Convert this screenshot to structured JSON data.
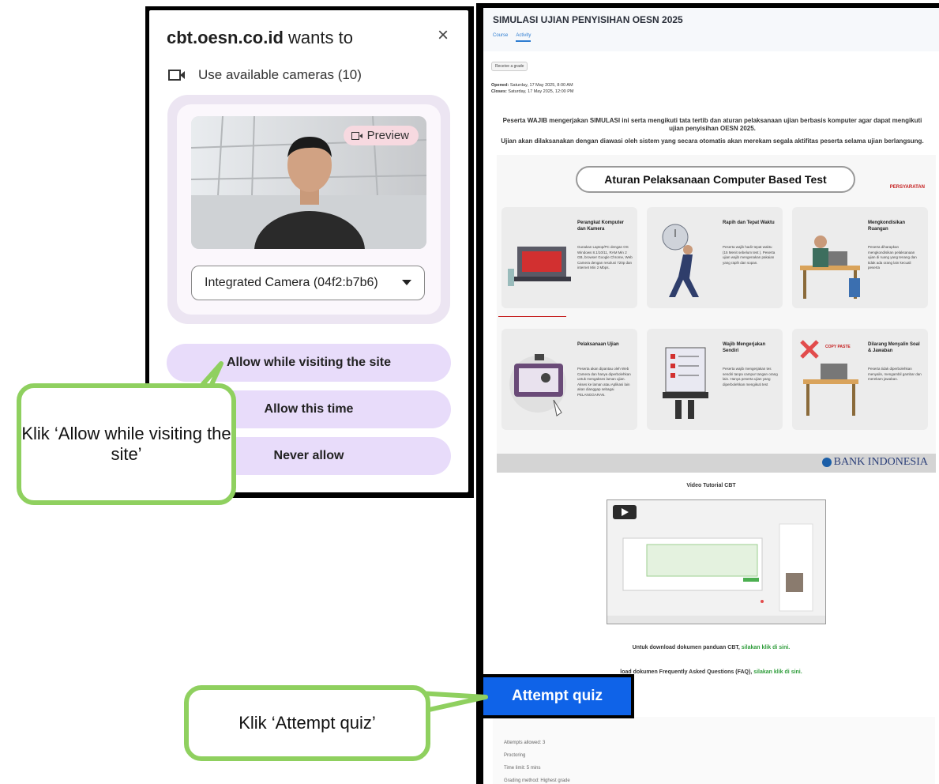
{
  "dialog": {
    "site": "cbt.oesn.co.id",
    "title_suffix": " wants to",
    "close_glyph": "×",
    "permission_label": "Use available cameras (10)",
    "preview_label": "Preview",
    "camera_select_value": "Integrated Camera (04f2:b7b6)",
    "buttons": {
      "allow_visit": "Allow while visiting the site",
      "allow_once": "Allow this time",
      "never": "Never allow"
    }
  },
  "callouts": {
    "allow": "Klik ‘Allow while visiting the site’",
    "attempt": "Klik ‘Attempt quiz’"
  },
  "page": {
    "title": "SIMULASI UJIAN PENYISIHAN OESN 2025",
    "nav": [
      "Course",
      "Activity"
    ],
    "grade_button": "Receive a grade",
    "opened_label": "Opened:",
    "opened_value": "Saturday, 17 May 2025, 8:00 AM",
    "closes_label": "Closes:",
    "closes_value": "Saturday, 17 May 2025, 12:00 PM",
    "intro_1": "Peserta WAJIB mengerjakan SIMULASI ini serta mengikuti tata tertib dan aturan pelaksanaan ujian berbasis komputer agar dapat mengikuti ujian penyisihan OESN 2025.",
    "intro_2": "Ujian akan dilaksanakan dengan diawasi oleh sistem yang secara otomatis akan merekam segala aktifitas peserta selama ujian berlangsung.",
    "infographic": {
      "title": "Aturan Pelaksanaan Computer Based Test",
      "tag_requirements": "PERSYARATAN",
      "tag_prohibitions": "LARANGAN",
      "cards": [
        {
          "title": "Perangkat Komputer dan Kamera",
          "body": "Gunakan Laptop/PC dengan OS Windows 8.1/10/11, RAM Min 2 GB, browser Google Chrome, Web Camera dengan resolusi 720p dan internet Min 2 Mbps."
        },
        {
          "title": "Rapih dan Tepat Waktu",
          "body": "Peserta wajib hadir tepat waktu (15 Menit sebelum test ). Peserta ujian wajib mengenakan pakaian yang rapih dan sopan."
        },
        {
          "title": "Mengkondisikan Ruangan",
          "body": "Peserta diharapkan mengkondisikan pelaksanaan ujian di ruang yang tenang dan tidak ada orang lain kecuali peserta"
        },
        {
          "title": "Pelaksanaan Ujian",
          "body": "Peserta akan dipantau oleh Web Camera dan hanya diperbolehkan untuk mengakses laman ujian. Akses ke laman atau Aplikasi lain akan dianggap sebagai PELANGGARAN."
        },
        {
          "title": "Wajib Mengerjakan Sendiri",
          "body": "Peserta wajib mengerjakan tes sendiri tanpa campur tangan orang lain. Hanya peserta ujian yang diperbolehkan mengikuti test"
        },
        {
          "title": "Dilarang Menyalin Soal & Jawaban",
          "body": "Peserta tidak diperbolehkan menyalin, mengambil gambar dan merekam jawaban."
        }
      ],
      "copy_paste": "COPY PASTE",
      "bank": "BANK INDONESIA"
    },
    "video_title": "Video Tutorial CBT",
    "download_1_prefix": "Untuk download dokumen panduan CBT, ",
    "download_1_link": "silakan klik di sini.",
    "download_2_prefix": "load dokumen Frequently Asked Questions (FAQ), ",
    "download_2_link": "silakan klik di sini.",
    "attempt_button": "Attempt quiz",
    "quiz_info": [
      "Attempts allowed: 3",
      "Proctoring",
      "Time limit: 5 mins",
      "Grading method: Highest grade"
    ]
  },
  "colors": {
    "dialog_button": "#e8dcfa",
    "callout_border": "#8fd05f",
    "attempt_button": "#0f63e8",
    "link_green": "#2e9c3a"
  }
}
